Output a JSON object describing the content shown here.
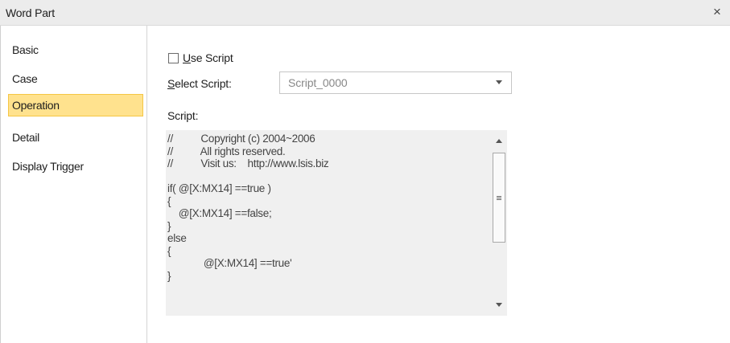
{
  "window": {
    "title": "Word Part",
    "close_glyph": "×"
  },
  "sidebar": {
    "items": [
      {
        "label": "Basic"
      },
      {
        "label": "Case"
      },
      {
        "label": "Operation"
      },
      {
        "label": "Detail"
      },
      {
        "label": "Display Trigger"
      }
    ],
    "selected": "Operation",
    "selected_bg": "#ffe28e"
  },
  "operation": {
    "use_script": {
      "mnemonic": "U",
      "rest": "se Script",
      "checked": false
    },
    "select_script": {
      "mnemonic": "S",
      "rest": "elect Script:",
      "value": "Script_0000"
    },
    "script_label": "Script:",
    "script_lines": [
      "//          Copyright (c) 2004~2006",
      "//          All rights reserved.",
      "//          Visit us:    http://www.lsis.biz",
      "",
      "if( @[X:MX14] ==true )",
      "{",
      "    @[X:MX14] ==false;",
      "}",
      "else",
      "{",
      "             @[X:MX14] ==true'",
      "}"
    ]
  },
  "icons": {
    "close": "close-icon",
    "dropdown": "chevron-down-icon",
    "scroll_up": "arrow-up-icon",
    "scroll_down": "arrow-down-icon"
  }
}
